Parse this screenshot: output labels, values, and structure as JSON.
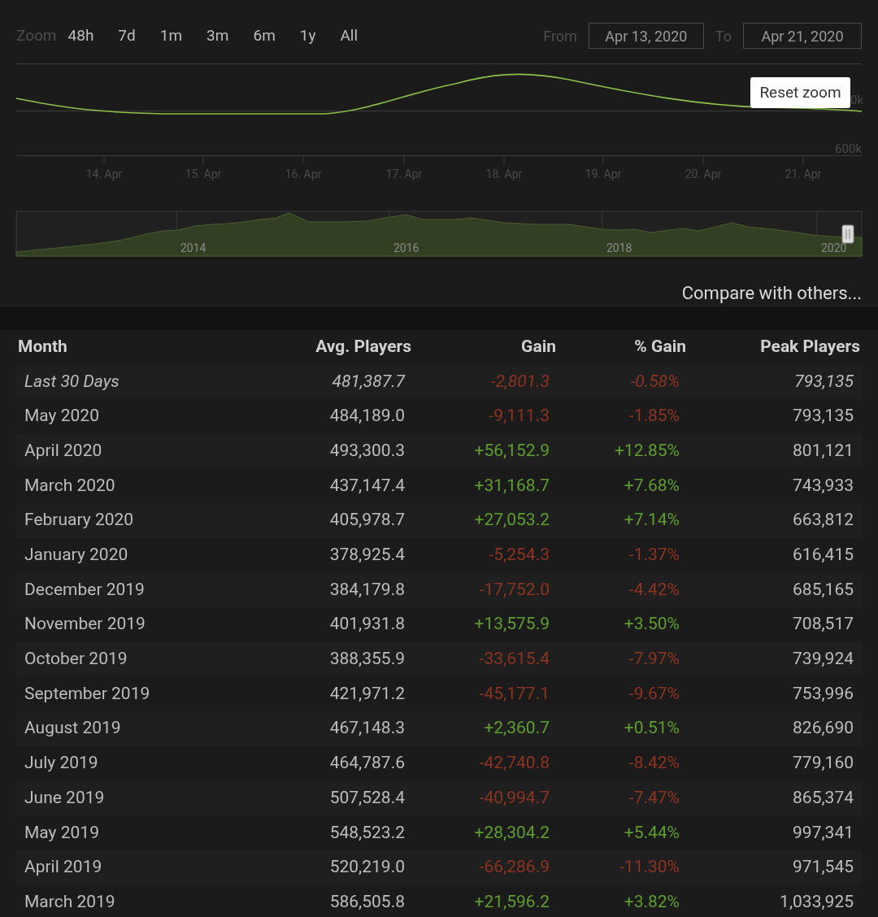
{
  "zoom": {
    "label": "Zoom",
    "options": [
      {
        "label": "48h",
        "selected": false
      },
      {
        "label": "7d",
        "selected": false
      },
      {
        "label": "1m",
        "selected": false
      },
      {
        "label": "3m",
        "selected": false
      },
      {
        "label": "6m",
        "selected": false
      },
      {
        "label": "1y",
        "selected": false
      },
      {
        "label": "All",
        "selected": false
      }
    ]
  },
  "range": {
    "from_label": "From",
    "from": "Apr 13, 2020",
    "to_label": "To",
    "to": "Apr 21, 2020"
  },
  "chart": {
    "reset_button": "Reset zoom",
    "y_labels": [
      "0k",
      "600k"
    ],
    "x_labels": [
      "14. Apr",
      "15. Apr",
      "16. Apr",
      "17. Apr",
      "18. Apr",
      "19. Apr",
      "20. Apr",
      "21. Apr"
    ]
  },
  "navigator": {
    "year_labels": [
      "2014",
      "2016",
      "2018",
      "2020"
    ]
  },
  "compare_link": "Compare with others...",
  "table": {
    "columns": [
      "Month",
      "Avg. Players",
      "Gain",
      "% Gain",
      "Peak Players"
    ],
    "rows": [
      {
        "kind": "summary",
        "positive": false,
        "cells": [
          "Last 30 Days",
          "481,387.7",
          "-2,801.3",
          "-0.58%",
          "793,135"
        ]
      },
      {
        "kind": "month",
        "positive": false,
        "cells": [
          "May 2020",
          "484,189.0",
          "-9,111.3",
          "-1.85%",
          "793,135"
        ]
      },
      {
        "kind": "month",
        "positive": true,
        "cells": [
          "April 2020",
          "493,300.3",
          "+56,152.9",
          "+12.85%",
          "801,121"
        ]
      },
      {
        "kind": "month",
        "positive": true,
        "cells": [
          "March 2020",
          "437,147.4",
          "+31,168.7",
          "+7.68%",
          "743,933"
        ]
      },
      {
        "kind": "month",
        "positive": true,
        "cells": [
          "February 2020",
          "405,978.7",
          "+27,053.2",
          "+7.14%",
          "663,812"
        ]
      },
      {
        "kind": "month",
        "positive": false,
        "cells": [
          "January 2020",
          "378,925.4",
          "-5,254.3",
          "-1.37%",
          "616,415"
        ]
      },
      {
        "kind": "month",
        "positive": false,
        "cells": [
          "December 2019",
          "384,179.8",
          "-17,752.0",
          "-4.42%",
          "685,165"
        ]
      },
      {
        "kind": "month",
        "positive": true,
        "cells": [
          "November 2019",
          "401,931.8",
          "+13,575.9",
          "+3.50%",
          "708,517"
        ]
      },
      {
        "kind": "month",
        "positive": false,
        "cells": [
          "October 2019",
          "388,355.9",
          "-33,615.4",
          "-7.97%",
          "739,924"
        ]
      },
      {
        "kind": "month",
        "positive": false,
        "cells": [
          "September 2019",
          "421,971.2",
          "-45,177.1",
          "-9.67%",
          "753,996"
        ]
      },
      {
        "kind": "month",
        "positive": true,
        "cells": [
          "August 2019",
          "467,148.3",
          "+2,360.7",
          "+0.51%",
          "826,690"
        ]
      },
      {
        "kind": "month",
        "positive": false,
        "cells": [
          "July 2019",
          "464,787.6",
          "-42,740.8",
          "-8.42%",
          "779,160"
        ]
      },
      {
        "kind": "month",
        "positive": false,
        "cells": [
          "June 2019",
          "507,528.4",
          "-40,994.7",
          "-7.47%",
          "865,374"
        ]
      },
      {
        "kind": "month",
        "positive": true,
        "cells": [
          "May 2019",
          "548,523.2",
          "+28,304.2",
          "+5.44%",
          "997,341"
        ]
      },
      {
        "kind": "month",
        "positive": false,
        "cells": [
          "April 2019",
          "520,219.0",
          "-66,286.9",
          "-11.30%",
          "971,545"
        ]
      },
      {
        "kind": "month",
        "positive": true,
        "cells": [
          "March 2019",
          "586,505.8",
          "+21,596.2",
          "+3.82%",
          "1,033,925"
        ]
      }
    ]
  }
}
